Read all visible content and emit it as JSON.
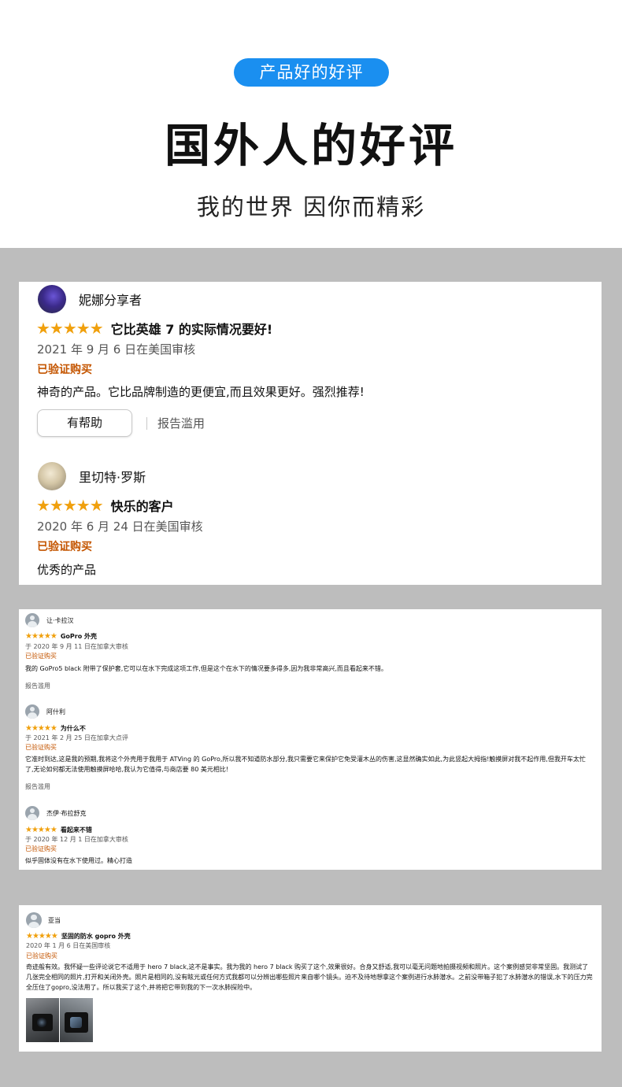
{
  "header": {
    "pill": "产品好的好评",
    "title": "国外人的好评",
    "subtitle": "我的世界 因你而精彩"
  },
  "colors": {
    "accent": "#1a8ff0",
    "star": "#f0a00d",
    "verified": "#c45500",
    "gray_bg": "#bdbdbd"
  },
  "card1": {
    "reviews": [
      {
        "name": "妮娜分享者",
        "stars": "★★★★★",
        "title": "它比英雄 7 的实际情况要好!",
        "date": "2021 年 9 月 6 日在美国审核",
        "verified": "已验证购买",
        "body": "神奇的产品。它比品牌制造的更便宜,而且效果更好。强烈推荐!",
        "helpful": "有帮助",
        "report": "报告滥用"
      },
      {
        "name": "里切特·罗斯",
        "stars": "★★★★★",
        "title": "快乐的客户",
        "date": "2020 年 6 月 24 日在美国审核",
        "verified": "已验证购买",
        "body": "优秀的产品"
      }
    ]
  },
  "card2": {
    "reviews": [
      {
        "name": "让·卡拉汉",
        "stars": "★★★★★",
        "title": "GoPro 外壳",
        "date": "于 2020 年 9 月 11 日在加拿大审核",
        "verified": "已验证购买",
        "body": "我的 GoPro5 black 附带了保护套,它可以在水下完成这项工作,但是这个在水下的情况要多得多,因为我非常高兴,而且看起来不错。",
        "report": "报告滥用"
      },
      {
        "name": "阿什利",
        "stars": "★★★★★",
        "title": "为什么不",
        "date": "于 2021 年 2 月 25 日在加拿大点评",
        "verified": "已验证购买",
        "body": "它准时到达,这是我的预期,我将这个外壳用于我用于 ATVing 的 GoPro,所以我不知道防水部分,我只需要它来保护它免受灌木丛的伤害,这显然确实如此,为此竖起大拇指!触摸屏对我不起作用,但我开车太忙了,无论如何都无法使用触摸屏哈哈,我认为它值得,与商店要 80 美元相比!",
        "report": "报告滥用"
      },
      {
        "name": "杰伊·布拉舒克",
        "stars": "★★★★★",
        "title": "看起来不错",
        "date": "于 2020 年 12 月 1 日在加拿大审核",
        "verified": "已验证购买",
        "body": "似乎固体没有在水下使用过。精心打造"
      }
    ]
  },
  "card3": {
    "review": {
      "name": "亚当",
      "stars": "★★★★★",
      "title": "坚固的防水 gopro 外壳",
      "date": "2020 年 1 月 6 日在美国审核",
      "verified": "已验证购买",
      "body": "奇迹般有效。我怀疑一些评论说它不适用于 hero 7 black,这不是事实。我为我的 hero 7 black 购买了这个,效果很好。合身又舒适,我可以毫无问题地拍摄视频和照片。这个案例感觉非常坚固。我测试了几张完全相同的照片,打开和关闭外壳。照片是相同的,没有眩光或任何方式我都可以分辨出哪些照片来自哪个镜头。迫不及待地想拿这个案例进行水肺潜水。之前没带箱子犯了水肺潜水的错误,水下的压力完全压住了gopro,没法用了。所以我买了这个,并将把它带到我的下一次水肺探险中。"
    }
  }
}
